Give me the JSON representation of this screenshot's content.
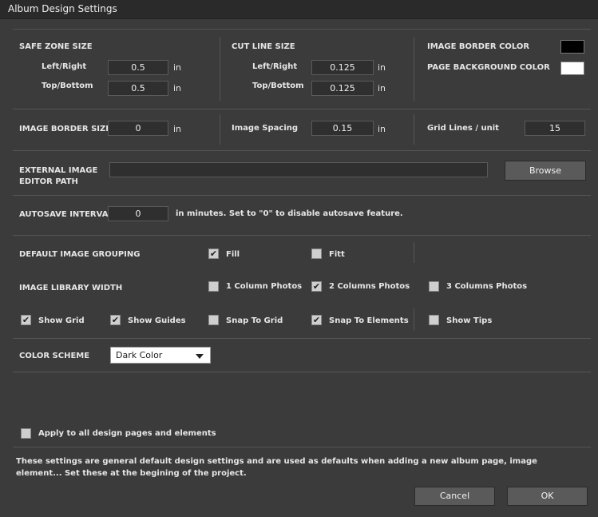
{
  "window": {
    "title": "Album Design Settings"
  },
  "safe_zone": {
    "heading": "SAFE ZONE SIZE",
    "left_right_label": "Left/Right",
    "left_right_value": "0.5",
    "top_bottom_label": "Top/Bottom",
    "top_bottom_value": "0.5",
    "unit": "in"
  },
  "cut_line": {
    "heading": "CUT LINE SIZE",
    "left_right_label": "Left/Right",
    "left_right_value": "0.125",
    "top_bottom_label": "Top/Bottom",
    "top_bottom_value": "0.125",
    "unit": "in"
  },
  "colors": {
    "image_border_label": "IMAGE BORDER COLOR",
    "image_border_value": "#000000",
    "page_background_label": "PAGE BACKGROUND COLOR",
    "page_background_value": "#ffffff"
  },
  "border_row": {
    "image_border_size_label": "IMAGE BORDER SIZE",
    "image_border_size_value": "0",
    "unit": "in",
    "image_spacing_label": "Image Spacing",
    "image_spacing_value": "0.15",
    "grid_lines_label": "Grid Lines / unit",
    "grid_lines_value": "15"
  },
  "editor": {
    "label_line1": "EXTERNAL IMAGE",
    "label_line2": "EDITOR PATH",
    "path_value": "",
    "browse_label": "Browse"
  },
  "autosave": {
    "label": "AUTOSAVE INTERVAL",
    "value": "0",
    "note": "in minutes.  Set to \"0\" to disable autosave feature."
  },
  "grouping": {
    "label": "DEFAULT IMAGE GROUPING",
    "fill_label": "Fill",
    "fill_checked": true,
    "fitt_label": "Fitt",
    "fitt_checked": false
  },
  "library": {
    "label": "IMAGE LIBRARY WIDTH",
    "one_col_label": "1 Column Photos",
    "one_col_checked": false,
    "two_col_label": "2 Columns Photos",
    "two_col_checked": true,
    "three_col_label": "3 Columns Photos",
    "three_col_checked": false
  },
  "toggles": {
    "show_grid_label": "Show Grid",
    "show_grid_checked": true,
    "show_guides_label": "Show Guides",
    "show_guides_checked": true,
    "snap_grid_label": "Snap To Grid",
    "snap_grid_checked": false,
    "snap_elements_label": "Snap To Elements",
    "snap_elements_checked": true,
    "show_tips_label": "Show Tips",
    "show_tips_checked": false
  },
  "color_scheme": {
    "label": "COLOR SCHEME",
    "selected": "Dark Color"
  },
  "apply_all": {
    "label": "Apply to all design pages and elements",
    "checked": false
  },
  "footer": {
    "note": "These settings are general default design settings and are used as defaults when adding a new album page, image element... Set these at the begining of the project.",
    "cancel_label": "Cancel",
    "ok_label": "OK"
  }
}
